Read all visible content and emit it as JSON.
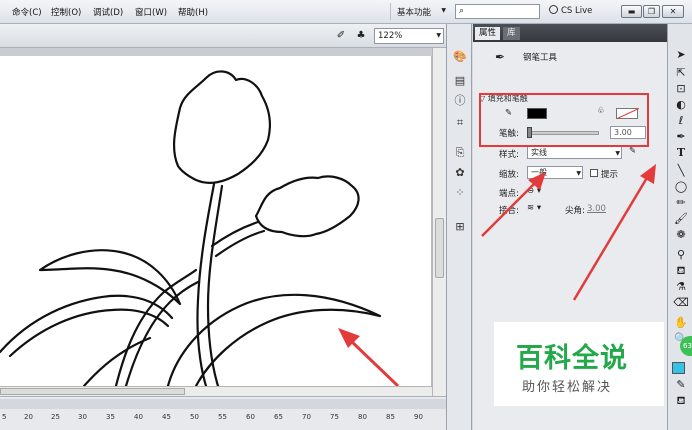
{
  "menu": {
    "items": [
      "命令(C)",
      "控制(O)",
      "调试(D)",
      "窗口(W)",
      "帮助(H)"
    ],
    "workspace": "基本功能",
    "cslive": "CS Live"
  },
  "stage": {
    "zoom": "122%",
    "ruler_ticks": [
      "5",
      "20",
      "25",
      "30",
      "35",
      "40",
      "45",
      "50",
      "55",
      "60",
      "65",
      "70",
      "75",
      "80",
      "85",
      "90"
    ],
    "hscroll_label": "III"
  },
  "panel": {
    "tabs": [
      "属性",
      "库"
    ],
    "tool_name": "钢笔工具",
    "section_title": "填充和笔触",
    "width_label": "笔触:",
    "width_value": "3.00",
    "style_label": "样式:",
    "style_value": "实线",
    "scale_label": "缩放:",
    "scale_value": "一般",
    "hint_label": "提示",
    "cap_label": "端点:",
    "join_label": "接合:",
    "miter_label": "尖角:",
    "miter_value": "3.00"
  },
  "watermark": {
    "title": "百科全说",
    "subtitle": "助你轻松解决"
  },
  "badge": "63",
  "colors": {
    "annotation": "#e23b3b",
    "watermark_green": "#23a84a",
    "canvas": "#ffffff"
  }
}
